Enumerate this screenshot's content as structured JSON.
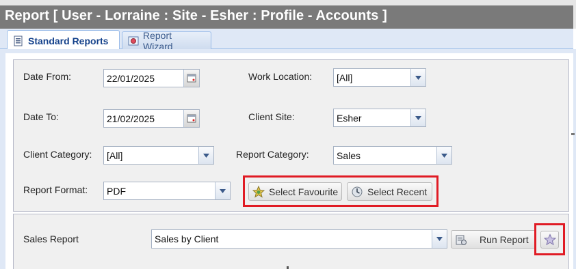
{
  "window": {
    "title": "Report [ User - Lorraine : Site - Esher : Profile - Accounts ]"
  },
  "tabs": [
    {
      "label": "Standard Reports",
      "icon": "report-list-icon",
      "active": true
    },
    {
      "label": "Report Wizard",
      "icon": "wizard-icon",
      "active": false
    }
  ],
  "filters": {
    "date_from": {
      "label": "Date From:",
      "value": "22/01/2025"
    },
    "date_to": {
      "label": "Date To:",
      "value": "21/02/2025"
    },
    "work_location": {
      "label": "Work Location:",
      "value": "[All]"
    },
    "client_site": {
      "label": "Client Site:",
      "value": "Esher"
    },
    "client_category": {
      "label": "Client Category:",
      "value": "[All]"
    },
    "report_category": {
      "label": "Report Category:",
      "value": "Sales"
    },
    "report_format": {
      "label": "Report Format:",
      "value": "PDF"
    }
  },
  "buttons": {
    "select_favourite": "Select Favourite",
    "select_recent": "Select Recent",
    "run_report": "Run Report"
  },
  "report": {
    "label": "Sales Report",
    "value": "Sales by Client"
  },
  "colors": {
    "title_bar": "#7a7a7a",
    "tab_text": "#15428b",
    "highlight_red": "#e01b24",
    "panel_bg": "#f0f0f0"
  }
}
